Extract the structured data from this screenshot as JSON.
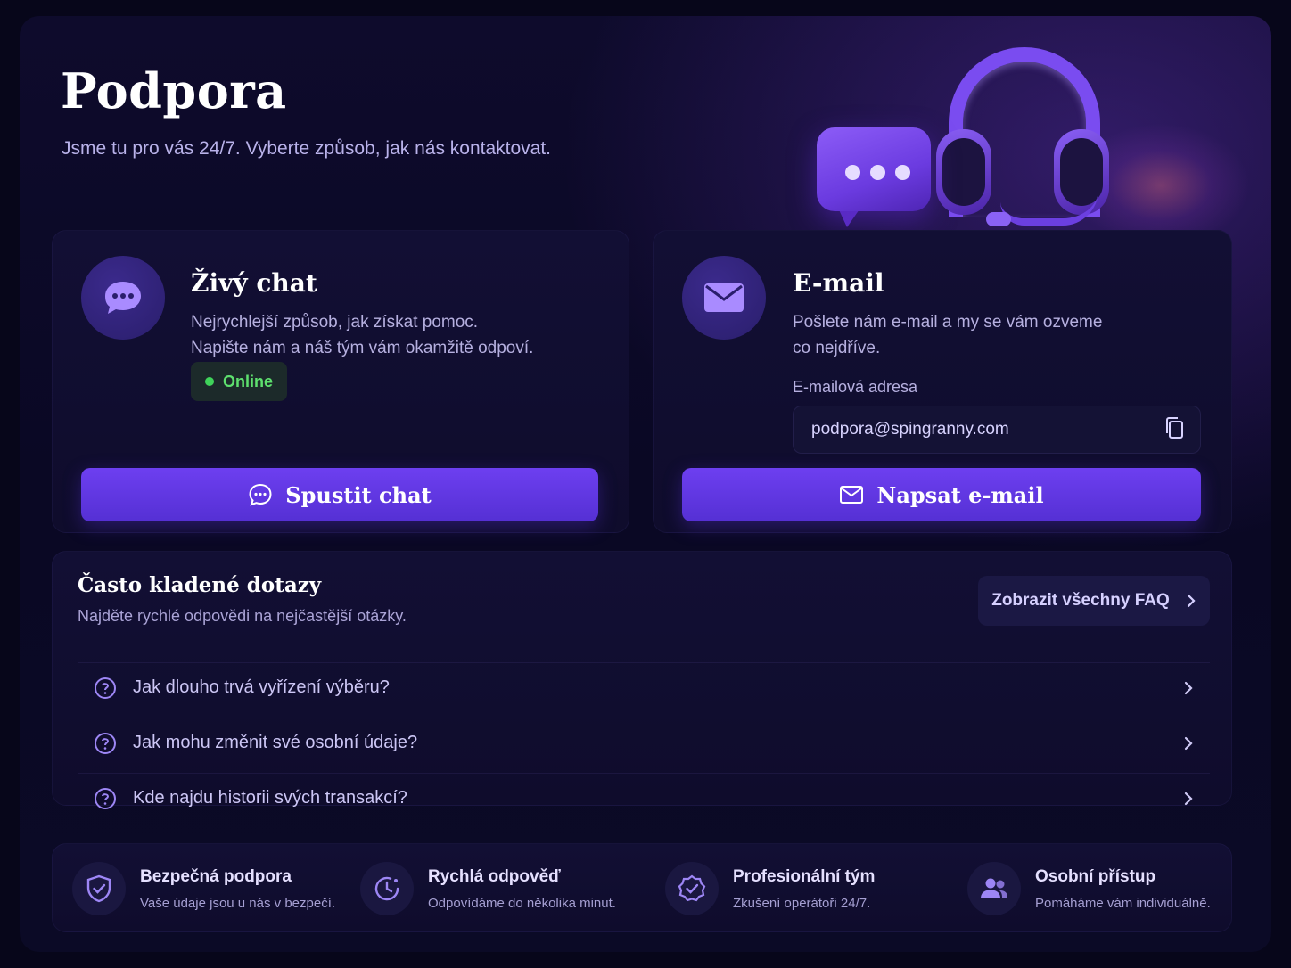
{
  "header": {
    "title": "Podpora",
    "subtitle": "Jsme tu pro vás 24/7. Vyberte způsob, jak nás kontaktovat."
  },
  "chat_card": {
    "title": "Živý chat",
    "desc_line1": "Nejrychlejší způsob, jak získat pomoc.",
    "desc_line2": "Napište nám a náš tým vám okamžitě odpoví.",
    "status": "Online",
    "button_label": "Spustit chat",
    "icon": "chat-bubble-icon"
  },
  "email_card": {
    "title": "E-mail",
    "desc_line1": "Pošlete nám e-mail a my se vám ozveme",
    "desc_line2": "co nejdříve.",
    "field_label": "E-mailová adresa",
    "email": "podpora@spingranny.com",
    "button_label": "Napsat e-mail",
    "icon": "envelope-icon"
  },
  "faq": {
    "title": "Často kladené dotazy",
    "subtitle": "Najděte rychlé odpovědi na nejčastější otázky.",
    "all_label": "Zobrazit všechny FAQ",
    "items": [
      {
        "question": "Jak dlouho trvá vyřízení výběru?"
      },
      {
        "question": "Jak mohu změnit své osobní údaje?"
      },
      {
        "question": "Kde najdu historii svých transakcí?"
      }
    ]
  },
  "features": [
    {
      "title": "Bezpečná podpora",
      "desc": "Vaše údaje jsou u nás v bezpečí.",
      "icon": "shield-icon"
    },
    {
      "title": "Rychlá odpověď",
      "desc": "Odpovídáme do několika minut.",
      "icon": "clock-icon"
    },
    {
      "title": "Profesionální tým",
      "desc": "Zkušení operátoři 24/7.",
      "icon": "verified-badge-icon"
    },
    {
      "title": "Osobní přístup",
      "desc": "Pomáháme vám individuálně.",
      "icon": "users-icon"
    }
  ],
  "colors": {
    "accent": "#6d3ff0",
    "online": "#3fd35a",
    "background": "#0e0b2c"
  }
}
